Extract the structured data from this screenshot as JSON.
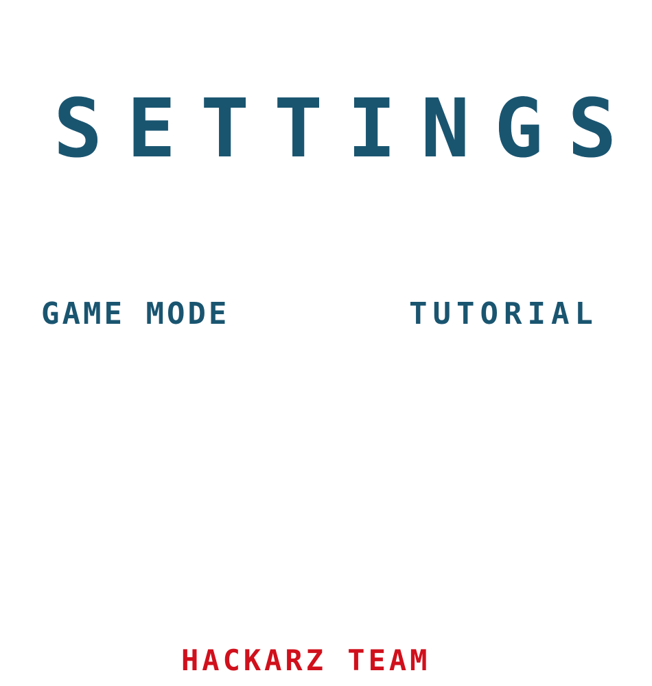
{
  "screen": {
    "title": "SETTINGS",
    "menu": {
      "game_mode_label": "GAME MODE",
      "tutorial_label": "TUTORIAL"
    },
    "footer": {
      "credit": "HACKARZ TEAM"
    }
  },
  "colors": {
    "title": "#1a5570",
    "menu_text": "#1a5570",
    "footer_text": "#d0101c",
    "background": "#ffffff"
  }
}
